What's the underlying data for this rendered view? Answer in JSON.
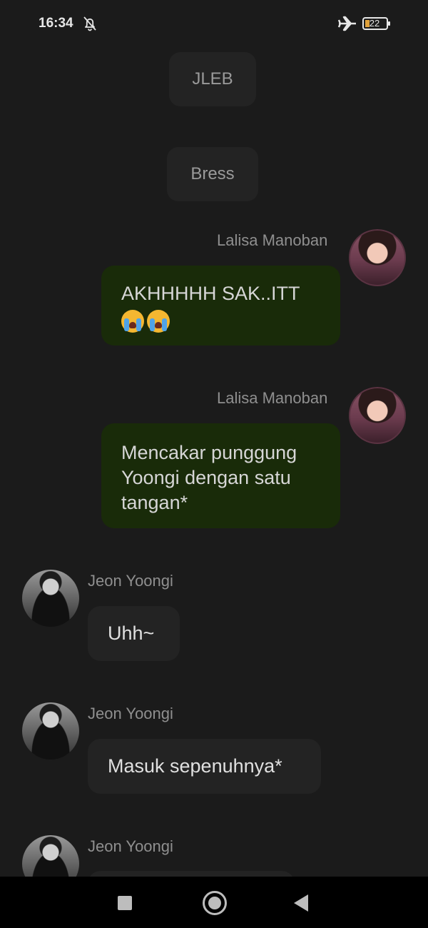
{
  "status_bar": {
    "time": "16:34",
    "notifications_icon": "bell-off-icon",
    "airplane_icon": "airplane-icon",
    "battery_level": "22"
  },
  "chat": {
    "narrations": [
      "JLEB",
      "Bress"
    ],
    "messages": [
      {
        "sender": "Lalisa Manoban",
        "text": "AKHHHHH SAK..ITT",
        "emoji": "loudly-crying-face x2",
        "outgoing": true
      },
      {
        "sender": "Lalisa Manoban",
        "text": "Mencakar punggung Yoongi dengan satu tangan*",
        "outgoing": true
      },
      {
        "sender": "Jeon Yoongi",
        "text": "Uhh~",
        "outgoing": false
      },
      {
        "sender": "Jeon Yoongi",
        "text": "Masuk sepenuhnya*",
        "outgoing": false
      },
      {
        "sender": "Jeon Yoongi",
        "text": "",
        "outgoing": false
      }
    ]
  },
  "colors": {
    "background": "#1b1b1b",
    "outgoing_bubble": "#192b09",
    "incoming_bubble": "#232323",
    "sender_name": "#8f8f8f"
  },
  "nav_bar": {
    "recents_icon": "square-icon",
    "home_icon": "circle-home-icon",
    "back_icon": "triangle-back-icon"
  }
}
